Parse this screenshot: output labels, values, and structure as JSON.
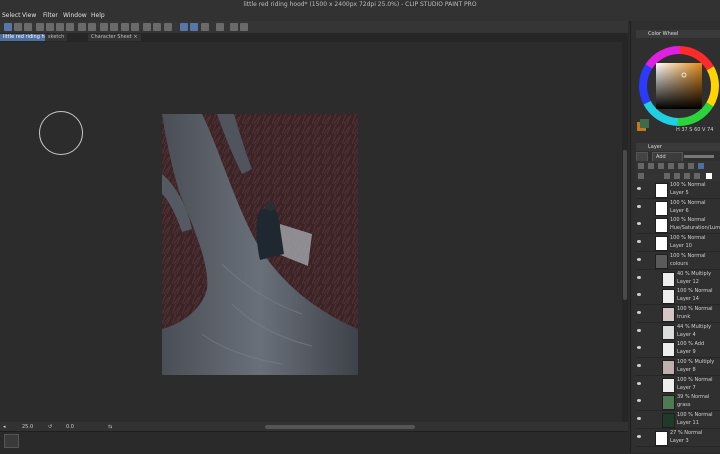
{
  "window": {
    "title": "little red riding hood* (1500 x 2400px 72dpi 25.0%) - CLIP STUDIO PAINT PRO"
  },
  "menu": [
    "Select",
    "View",
    "Filter",
    "Window",
    "Help"
  ],
  "tabs": [
    {
      "label": "little red riding hood* ×",
      "active": true
    },
    {
      "label": "sketch",
      "active": false
    },
    {
      "label": "Character Sheet ×",
      "active": false
    }
  ],
  "status": {
    "zoom": "25.0",
    "angle": "0.0"
  },
  "color_wheel": {
    "title": "Color Wheel",
    "values": "H 37  S 60  V 74"
  },
  "layer_panel": {
    "title": "Layer",
    "blend_mode": "Add",
    "layers": [
      {
        "blend": "100 % Normal",
        "name": "Layer 5",
        "thumb": "#ffffff",
        "indent": 0
      },
      {
        "blend": "100 % Normal",
        "name": "Layer 6",
        "thumb": "#ffffff",
        "indent": 0
      },
      {
        "blend": "100 % Normal",
        "name": "Hue/Saturation/Lum",
        "thumb": "#ffffff",
        "indent": 0
      },
      {
        "blend": "100 % Normal",
        "name": "Layer 10",
        "thumb": "#ffffff",
        "indent": 0
      },
      {
        "blend": "100 % Normal",
        "name": "colours",
        "thumb": "#5a5a5a",
        "indent": 0
      },
      {
        "blend": "40 % Multiply",
        "name": "Layer 12",
        "thumb": "#eeeeee",
        "indent": 1
      },
      {
        "blend": "100 % Normal",
        "name": "Layer 14",
        "thumb": "#eeeeee",
        "indent": 1
      },
      {
        "blend": "100 % Normal",
        "name": "trunk",
        "thumb": "#d6c6c6",
        "indent": 1
      },
      {
        "blend": "44 % Multiply",
        "name": "Layer 4",
        "thumb": "#dcdcdc",
        "indent": 1
      },
      {
        "blend": "100 % Add",
        "name": "Layer 9",
        "thumb": "#eeeeee",
        "indent": 1
      },
      {
        "blend": "100 % Multiply",
        "name": "Layer 8",
        "thumb": "#bfaeb0",
        "indent": 1
      },
      {
        "blend": "100 % Normal",
        "name": "Layer 7",
        "thumb": "#eeeeee",
        "indent": 1
      },
      {
        "blend": "39 % Normal",
        "name": "grass",
        "thumb": "#4f7b54",
        "indent": 1
      },
      {
        "blend": "100 % Normal",
        "name": "Layer 11",
        "thumb": "#1e3a28",
        "indent": 1
      },
      {
        "blend": "27 % Normal",
        "name": "Layer 3",
        "thumb": "#ffffff",
        "indent": 0
      }
    ]
  }
}
